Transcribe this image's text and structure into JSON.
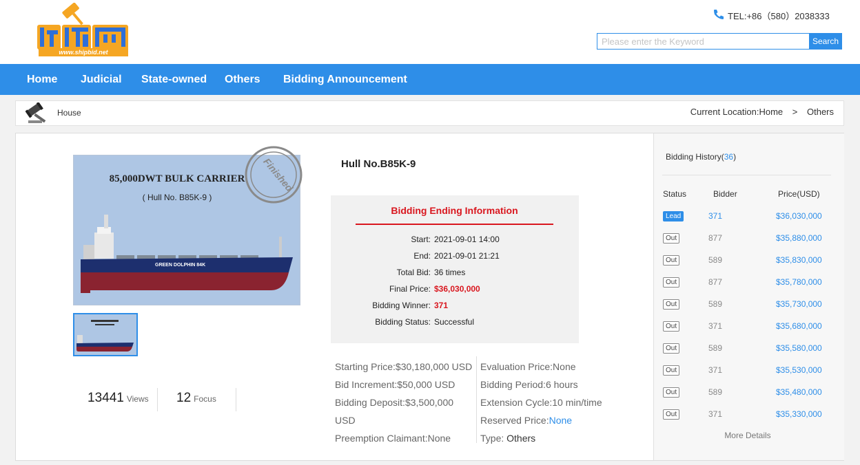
{
  "header": {
    "phone": "TEL:+86（580）2038333",
    "search_placeholder": "Please enter the Keyword",
    "search_button": "Search",
    "logo_url_text": "www.shipbid.net"
  },
  "nav": [
    "Home",
    "Judicial",
    "State-owned",
    "Others",
    "Bidding Announcement"
  ],
  "breadcrumb": {
    "category": "House",
    "location_label": "Current Location:",
    "path": [
      "Home",
      "Others"
    ],
    "separator": ">"
  },
  "lot": {
    "photo_title": "85,000DWT BULK CARRIER",
    "photo_subtitle": "( Hull No. B85K-9 )",
    "photo_ship_name": "GREEN DOLPHIN 84K",
    "stamp": "Finished",
    "title": "Hull No.B85K-9",
    "views": "13441",
    "views_label": "Views",
    "focus": "12",
    "focus_label": "Focus"
  },
  "ending": {
    "title": "Bidding Ending Information",
    "rows": [
      {
        "label": "Start:",
        "value": "2021-09-01 14:00",
        "red": false
      },
      {
        "label": "End:",
        "value": "2021-09-01 21:21",
        "red": false
      },
      {
        "label": "Total Bid:",
        "value": "36 times",
        "red": false
      },
      {
        "label": "Final Price:",
        "value": "$36,030,000",
        "red": true
      },
      {
        "label": "Bidding Winner:",
        "value": "371",
        "red": true
      },
      {
        "label": "Bidding Status:",
        "value": "Successful",
        "red": false
      }
    ]
  },
  "details": {
    "starting_price": "Starting Price:$30,180,000 USD",
    "increment": "Bid Increment:$50,000 USD",
    "deposit_1": "Bidding Deposit:$3,500,000",
    "deposit_2": "USD",
    "preemption": "Preemption Claimant:None",
    "evaluation": "Evaluation Price:None",
    "period": "Bidding Period:6 hours",
    "extension": "Extension Cycle:10 min/time",
    "reserved_label": "Reserved Price:",
    "reserved_value": "None",
    "type_label": "Type:",
    "type_value": "Others"
  },
  "history": {
    "title": "Bidding History",
    "count": "36",
    "headers": [
      "Status",
      "Bidder",
      "Price(USD)"
    ],
    "rows": [
      {
        "status": "Lead",
        "bidder": "371",
        "price": "$36,030,000"
      },
      {
        "status": "Out",
        "bidder": "877",
        "price": "$35,880,000"
      },
      {
        "status": "Out",
        "bidder": "589",
        "price": "$35,830,000"
      },
      {
        "status": "Out",
        "bidder": "877",
        "price": "$35,780,000"
      },
      {
        "status": "Out",
        "bidder": "589",
        "price": "$35,730,000"
      },
      {
        "status": "Out",
        "bidder": "371",
        "price": "$35,680,000"
      },
      {
        "status": "Out",
        "bidder": "589",
        "price": "$35,580,000"
      },
      {
        "status": "Out",
        "bidder": "371",
        "price": "$35,530,000"
      },
      {
        "status": "Out",
        "bidder": "589",
        "price": "$35,480,000"
      },
      {
        "status": "Out",
        "bidder": "371",
        "price": "$35,330,000"
      }
    ],
    "more": "More Details"
  },
  "colors": {
    "primary": "#2e8ee8",
    "accent_red": "#d9161e",
    "logo_orange": "#f5a623"
  }
}
